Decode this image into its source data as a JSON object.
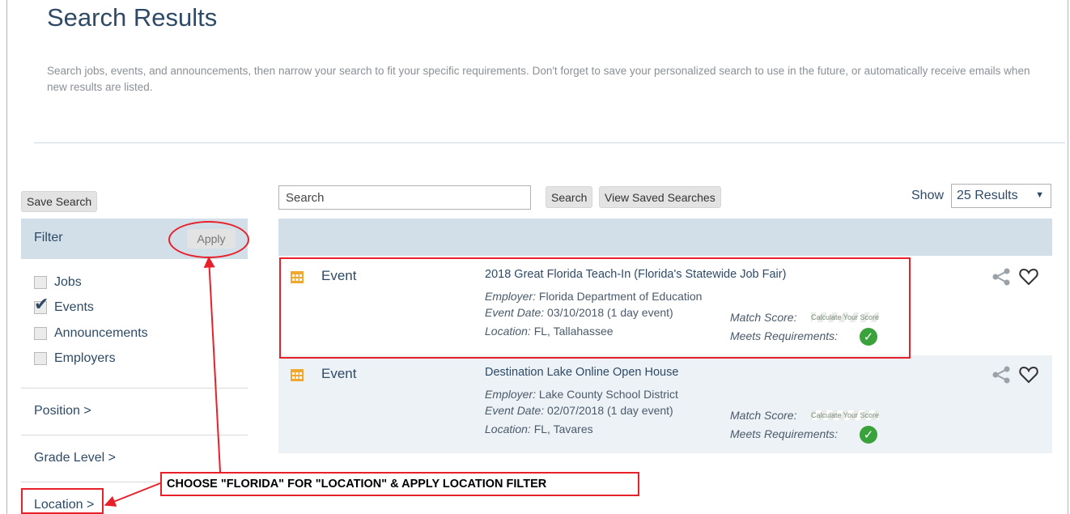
{
  "page": {
    "title": "Search Results",
    "intro": "Search jobs, events, and announcements, then narrow your search to fit your specific requirements. Don't forget to save your personalized search to use in the future, or automatically receive emails when new results are listed."
  },
  "toolbar": {
    "save_search_label": "Save Search",
    "search_placeholder": "Search",
    "search_label": "Search",
    "view_saved_label": "View Saved Searches",
    "show_label": "Show",
    "show_value": "25 Results"
  },
  "filter": {
    "title": "Filter",
    "apply_label": "Apply",
    "checkboxes": [
      {
        "label": "Jobs",
        "checked": false
      },
      {
        "label": "Events",
        "checked": true
      },
      {
        "label": "Announcements",
        "checked": false
      },
      {
        "label": "Employers",
        "checked": false
      }
    ],
    "facets": [
      "Position >",
      "Grade Level >",
      "Location >"
    ]
  },
  "results": [
    {
      "type": "Event",
      "title": "2018 Great Florida Teach-In (Florida's Statewide Job Fair)",
      "employer_key": "Employer:",
      "employer": "Florida Department of Education",
      "date_key": "Event Date:",
      "date": "03/10/2018 (1 day event)",
      "location_key": "Location:",
      "location": "FL, Tallahassee",
      "match_label": "Match Score:",
      "calc_label": "Calculate Your Score",
      "meets_label": "Meets Requirements:"
    },
    {
      "type": "Event",
      "title": "Destination Lake Online Open House",
      "employer_key": "Employer:",
      "employer": "Lake County School District",
      "date_key": "Event Date:",
      "date": "02/07/2018 (1 day event)",
      "location_key": "Location:",
      "location": "FL, Tavares",
      "match_label": "Match Score:",
      "calc_label": "Calculate Your Score",
      "meets_label": "Meets Requirements:"
    }
  ],
  "annotation": {
    "callout": "CHOOSE \"FLORIDA\" FOR \"LOCATION\" & APPLY LOCATION FILTER",
    "color": "#e8202a"
  },
  "colors": {
    "accent": "#2e4a66",
    "header_band": "#d2dfe8",
    "success": "#3aa23a",
    "calendar_icon": "#f0a830"
  },
  "icons": [
    "calendar-icon",
    "share-icon",
    "heart-icon",
    "checkmark-icon",
    "chevron-down-icon"
  ]
}
